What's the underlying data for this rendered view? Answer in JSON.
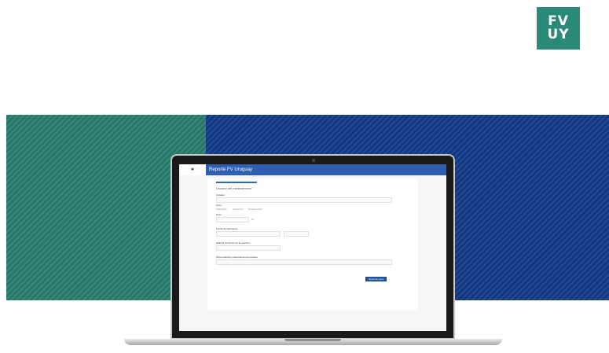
{
  "logo": {
    "line1": "FV",
    "line2": "UY"
  },
  "colors": {
    "brand_green": "#2a7f72",
    "brand_blue": "#133c8c",
    "accent_blue": "#1c4f9c"
  },
  "app": {
    "title": "Reporte FV Uruguay",
    "logo_icon": "app-logo-icon",
    "form": {
      "title": "Usuario del medicamento",
      "progress_fraction": 0.2,
      "fields": [
        {
          "label": "Iniciales"
        },
        {
          "label": "Sexo",
          "options": [
            "Masculino",
            "Femenino",
            "Desconocido"
          ]
        },
        {
          "label": "Peso",
          "unit": "kg"
        },
        {
          "label": "Fecha de nacimiento"
        },
        {
          "label": "Edad al comienzo de la reacción"
        },
        {
          "label": "Otra condición preexistente que tuviese"
        }
      ],
      "submit_label": "Siguiente paso"
    }
  }
}
